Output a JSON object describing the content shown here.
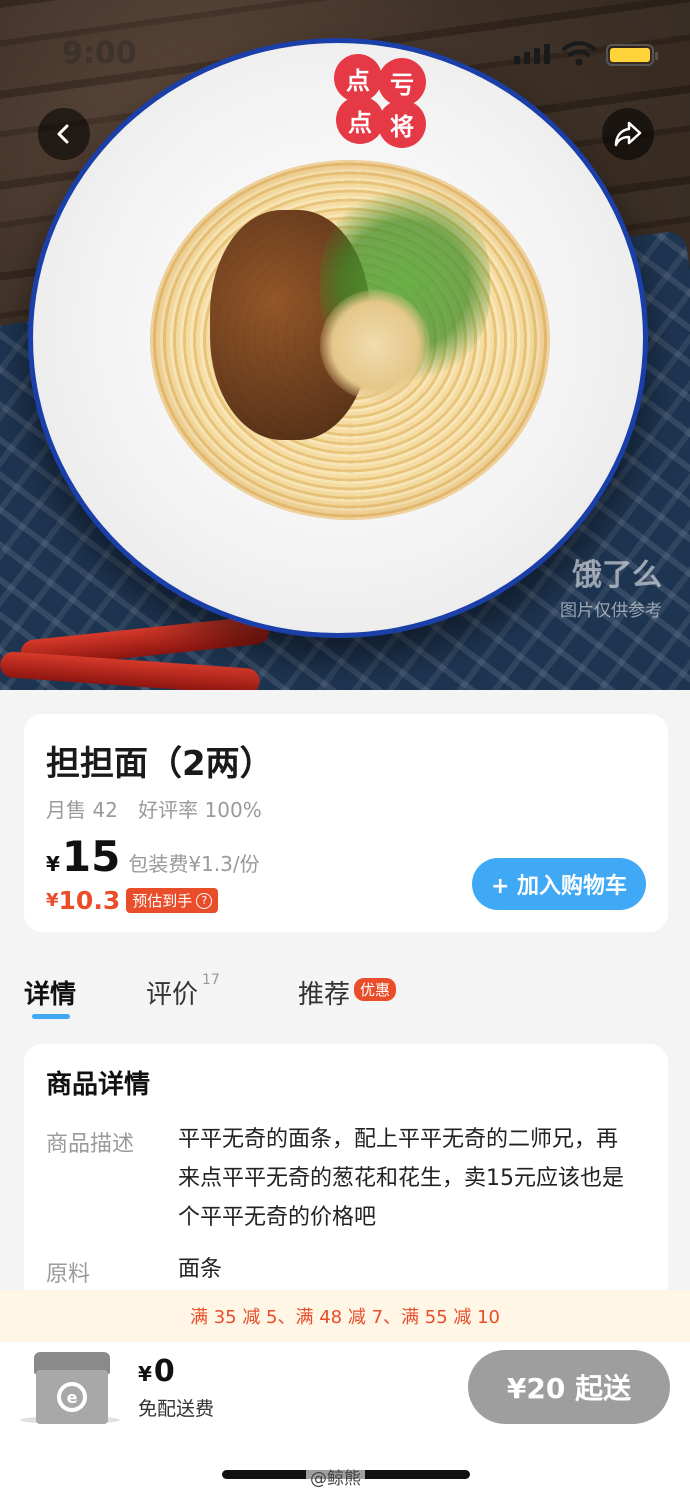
{
  "status_bar": {
    "time": "9:00"
  },
  "hero": {
    "bowl_logo": [
      "点",
      "亏",
      "点",
      "将"
    ],
    "watermark_brand": "饿了么",
    "watermark_caption": "图片仅供参考"
  },
  "nav": {
    "back_icon": "chevron-left-icon",
    "share_icon": "share-arrow-icon"
  },
  "product": {
    "title": "担担面（2两）",
    "monthly_sales": "月售 42",
    "rating": "好评率 100%",
    "currency": "¥",
    "price": "15",
    "packaging_fee": "包装费¥1.3/份",
    "estimated_price": "10.3",
    "estimated_tag": "预估到手",
    "add_to_cart": "+ 加入购物车"
  },
  "tabs": [
    {
      "label": "详情",
      "active": true
    },
    {
      "label": "评价",
      "count": "17"
    },
    {
      "label": "推荐",
      "badge": "优惠"
    }
  ],
  "detail": {
    "title": "商品详情",
    "description_label": "商品描述",
    "description": "平平无奇的面条，配上平平无奇的二师兄，再来点平平无奇的葱花和花生，卖15元应该也是个平平无奇的价格吧",
    "ingredients_label": "原料",
    "ingredients": "面条"
  },
  "promo": {
    "text": "满 35 减 5、满 48 减 7、满 55 减 10"
  },
  "cart": {
    "currency": "¥",
    "amount": "0",
    "delivery": "免配送费",
    "min_order": "¥20 起送"
  },
  "footer": {
    "weibo_watermark": "@鲸熊"
  },
  "colors": {
    "accent": "#3fa9f5",
    "price_red": "#e94d2a",
    "bowl_rim": "#1b3fa8"
  }
}
